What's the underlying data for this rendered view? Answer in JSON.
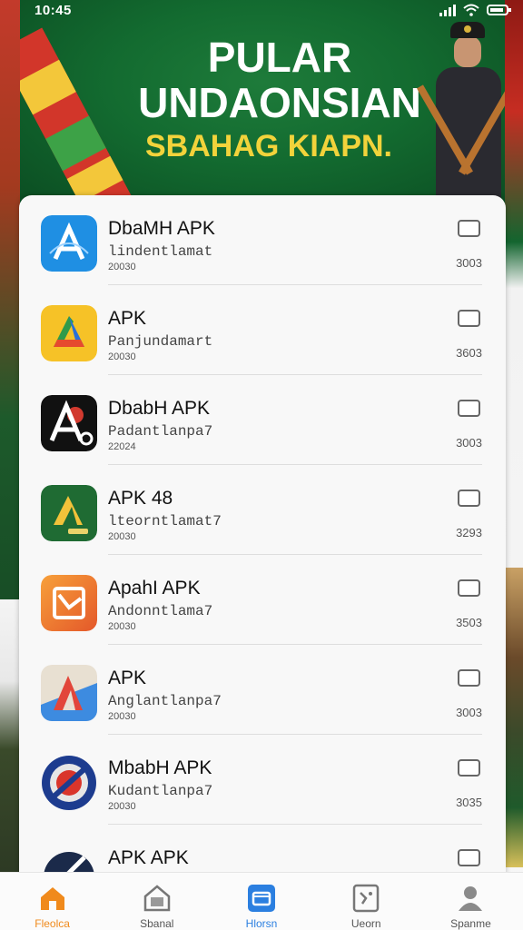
{
  "status_bar": {
    "time": "10:45"
  },
  "hero": {
    "title_line1": "PULAR",
    "title_line2": "UNDAONSIAN",
    "subtitle": "SBAHAG KIAPN."
  },
  "apps": [
    {
      "name": "DbaMH APK",
      "sub": "lindentlamat",
      "date": "20030",
      "size": "3003",
      "checked": false
    },
    {
      "name": "APK",
      "sub": "Panjundamart",
      "date": "20030",
      "size": "3603",
      "checked": false
    },
    {
      "name": "DbabH APK",
      "sub": "Padantlanpa7",
      "date": "22024",
      "size": "3003",
      "checked": false
    },
    {
      "name": "APK 48",
      "sub": "lteorntlamat7",
      "date": "20030",
      "size": "3293",
      "checked": false
    },
    {
      "name": "ApahI APK",
      "sub": "Andonntlama7",
      "date": "20030",
      "size": "3503",
      "checked": false
    },
    {
      "name": "APK",
      "sub": "Anglantlanpa7",
      "date": "20030",
      "size": "3003",
      "checked": false
    },
    {
      "name": "MbabH APK",
      "sub": "Kudantlanpa7",
      "date": "20030",
      "size": "3035",
      "checked": false
    },
    {
      "name": "APK APK",
      "sub": "",
      "date": "",
      "size": "",
      "checked": false
    }
  ],
  "nav": [
    {
      "label": "Fleolca",
      "icon": "home-icon",
      "active": true
    },
    {
      "label": "Sbanal",
      "icon": "store-icon",
      "active": false
    },
    {
      "label": "Hlorsn",
      "icon": "folder-icon",
      "active": false
    },
    {
      "label": "Ueorn",
      "icon": "apps-icon",
      "active": false
    },
    {
      "label": "Spanme",
      "icon": "profile-icon",
      "active": false
    }
  ],
  "colors": {
    "hero_green": "#136b30",
    "accent_yellow": "#f2d33b",
    "nav_active": "#f08a1c",
    "nav_blue": "#2b7fe0"
  }
}
